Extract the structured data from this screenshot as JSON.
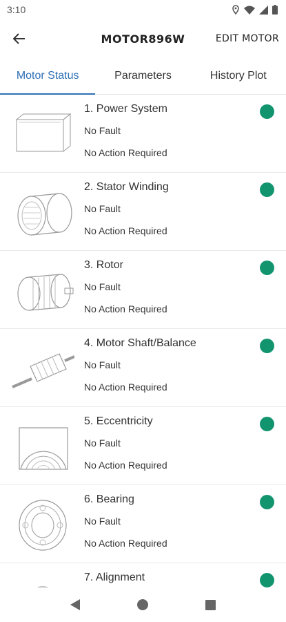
{
  "status_bar": {
    "time": "3:10"
  },
  "app_bar": {
    "title": "MOTOR896W",
    "edit_label": "EDIT MOTOR"
  },
  "tabs": [
    {
      "label": "Motor Status",
      "active": true
    },
    {
      "label": "Parameters",
      "active": false
    },
    {
      "label": "History Plot",
      "active": false
    }
  ],
  "components": [
    {
      "title": "1. Power System",
      "fault": "No Fault",
      "action": "No Action Required",
      "icon": "power-system-icon"
    },
    {
      "title": "2. Stator Winding",
      "fault": "No Fault",
      "action": "No Action Required",
      "icon": "stator-winding-icon"
    },
    {
      "title": "3. Rotor",
      "fault": "No Fault",
      "action": "No Action Required",
      "icon": "rotor-icon"
    },
    {
      "title": "4. Motor Shaft/Balance",
      "fault": "No Fault",
      "action": "No Action Required",
      "icon": "motor-shaft-icon"
    },
    {
      "title": "5. Eccentricity",
      "fault": "No Fault",
      "action": "No Action Required",
      "icon": "eccentricity-icon"
    },
    {
      "title": "6. Bearing",
      "fault": "No Fault",
      "action": "No Action Required",
      "icon": "bearing-icon"
    },
    {
      "title": "7. Alignment",
      "fault": "",
      "action": "",
      "icon": "alignment-icon"
    }
  ],
  "colors": {
    "accent": "#2c6fb6",
    "status_ok": "#12946f"
  }
}
